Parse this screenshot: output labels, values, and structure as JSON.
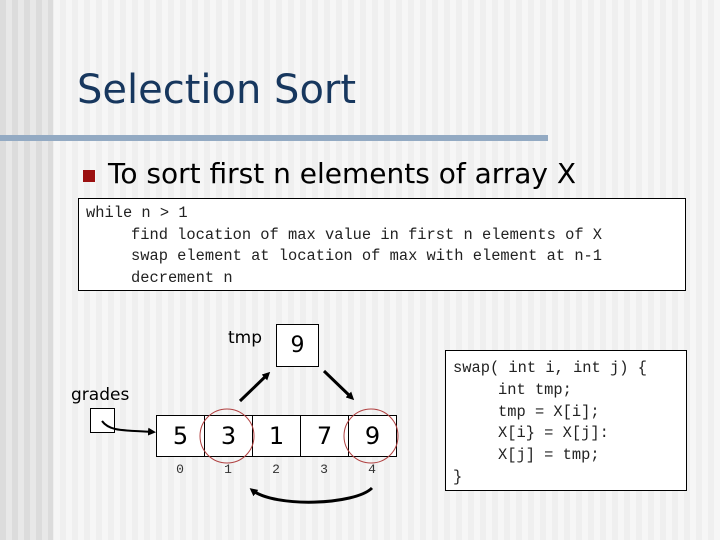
{
  "slide": {
    "title": "Selection Sort",
    "bullet": "To sort first n elements of array X",
    "accent_color": "#17375e",
    "bullet_color": "#9b1010",
    "divider_color": "#93aac3"
  },
  "algorithm": {
    "lines": [
      "while n > 1",
      "find location of max value in first n elements of X",
      "swap element at location of max with element at n-1",
      "decrement n"
    ]
  },
  "diagram": {
    "tmp_label": "tmp",
    "tmp_value": "9",
    "array_label": "grades",
    "cells": [
      "5",
      "3",
      "1",
      "7",
      "9"
    ],
    "indices": [
      "0",
      "1",
      "2",
      "3",
      "4"
    ],
    "highlighted_indices": [
      1,
      4
    ],
    "highlight_color": "#b04040"
  },
  "swap_code": {
    "lines": [
      "swap( int i, int j) {",
      "int tmp;",
      "tmp = X[i];",
      "X[i} = X[j]:",
      "X[j] = tmp;",
      "}"
    ]
  }
}
